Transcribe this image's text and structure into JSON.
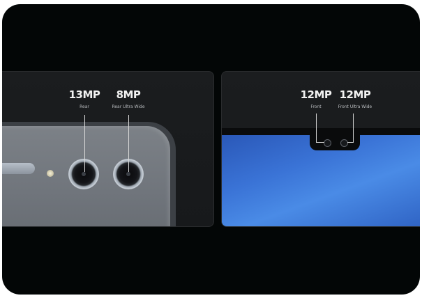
{
  "left_panel": {
    "cameras": [
      {
        "megapixels": "13MP",
        "label": "Rear"
      },
      {
        "megapixels": "8MP",
        "label": "Rear Ultra Wide"
      }
    ]
  },
  "right_panel": {
    "cameras": [
      {
        "megapixels": "12MP",
        "label": "Front"
      },
      {
        "megapixels": "12MP",
        "label": "Front Ultra Wide"
      }
    ]
  }
}
